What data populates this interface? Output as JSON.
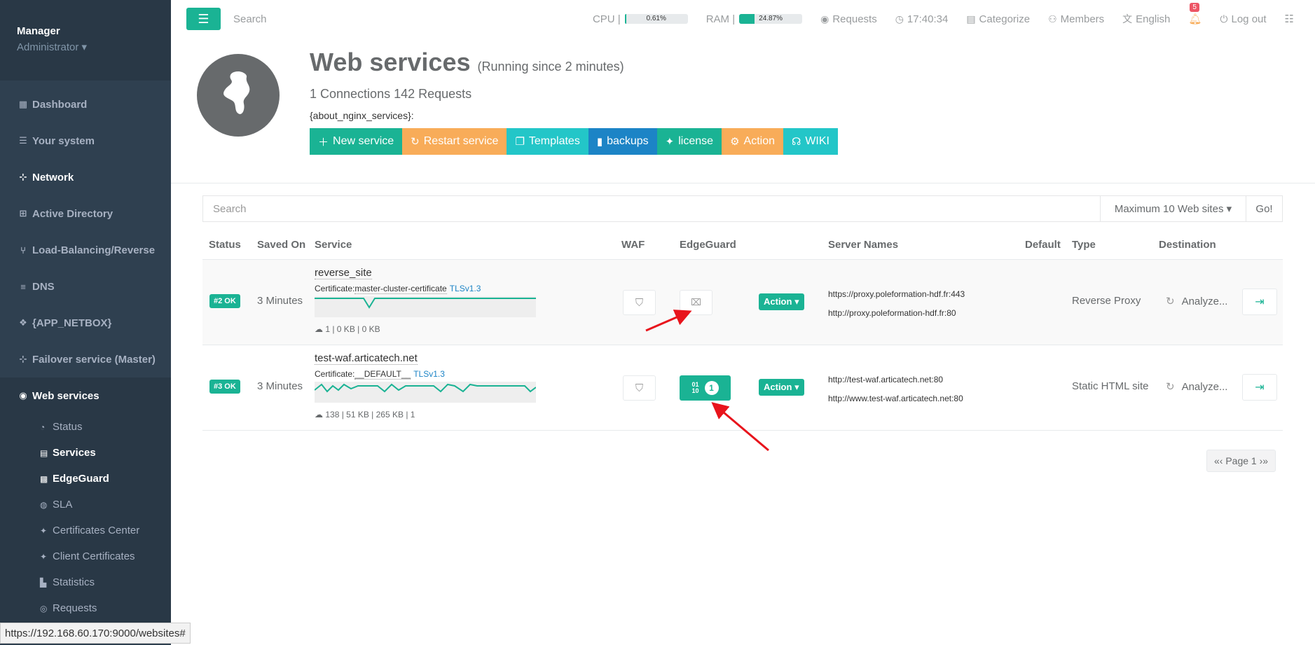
{
  "sidebar": {
    "user": "Manager",
    "role": "Administrator",
    "items": [
      {
        "label": "Dashboard",
        "icon": "dashboard-icon"
      },
      {
        "label": "Your system",
        "icon": "server-icon"
      },
      {
        "label": "Network",
        "icon": "sitemap-icon"
      },
      {
        "label": "Active Directory",
        "icon": "windows-icon"
      },
      {
        "label": "Load-Balancing/Reverse",
        "icon": "branch-icon"
      },
      {
        "label": "DNS",
        "icon": "database-icon"
      },
      {
        "label": "{APP_NETBOX}",
        "icon": "cube-icon"
      },
      {
        "label": "Failover service (Master)",
        "icon": "sitemap-icon"
      },
      {
        "label": "Web services",
        "icon": "globe-icon"
      }
    ],
    "subitems": [
      {
        "label": "Status"
      },
      {
        "label": "Services"
      },
      {
        "label": "EdgeGuard"
      },
      {
        "label": "SLA"
      },
      {
        "label": "Certificates Center"
      },
      {
        "label": "Client Certificates"
      },
      {
        "label": "Statistics"
      },
      {
        "label": "Requests"
      }
    ]
  },
  "topbar": {
    "search_placeholder": "Search",
    "cpu_label": "CPU |",
    "cpu_value": "0.61%",
    "cpu_fraction": 0.0061,
    "ram_label": "RAM |",
    "ram_value": "24.87%",
    "ram_fraction": 0.2487,
    "requests": "Requests",
    "time": "17:40:34",
    "categorize": "Categorize",
    "members": "Members",
    "language": "English",
    "notifications": "5",
    "logout": "Log out"
  },
  "header": {
    "title": "Web services",
    "subtitle": "(Running since 2 minutes)",
    "connections": "1 Connections 142 Requests",
    "about": "{about_nginx_services}:",
    "buttons": [
      "New service",
      "Restart service",
      "Templates",
      "backups",
      "license",
      "Action",
      "WIKI"
    ]
  },
  "search": {
    "placeholder": "Search",
    "max_label": "Maximum 10 Web sites",
    "go_label": "Go!"
  },
  "table": {
    "columns": [
      "Status",
      "Saved On",
      "Service",
      "WAF",
      "EdgeGuard",
      "Server Names",
      "Default",
      "Type",
      "Destination"
    ],
    "rows": [
      {
        "status": "#2 OK",
        "saved": "3 Minutes",
        "service": "reverse_site",
        "cert_label": "Certificate:",
        "cert": "master-cluster-certificate",
        "tls": "TLSv1.3",
        "stats": "1  |  0 KB  |  0 KB",
        "action": "Action",
        "servers": [
          "https://proxy.poleformation-hdf.fr:443",
          "http://proxy.poleformation-hdf.fr:80"
        ],
        "type": "Reverse Proxy",
        "destination": "Analyze..."
      },
      {
        "status": "#3 OK",
        "saved": "3 Minutes",
        "service": "test-waf.articatech.net",
        "cert_label": "Certificate:",
        "cert": "__DEFAULT__",
        "tls": "TLSv1.3",
        "stats": "138  |  51 KB  |  265 KB  |  1",
        "edgeguard_count": "1",
        "action": "Action",
        "servers": [
          "http://test-waf.articatech.net:80",
          "http://www.test-waf.articatech.net:80"
        ],
        "type": "Static HTML site",
        "destination": "Analyze..."
      }
    ]
  },
  "pager": "«‹ Page 1 ›»",
  "statusbar": "https://192.168.60.170:9000/websites#",
  "colors": {
    "accent": "#1ab394",
    "orange": "#f8ac59",
    "cyan": "#23c6c8",
    "blue": "#1c84c6",
    "sidebar": "#2f4050"
  }
}
